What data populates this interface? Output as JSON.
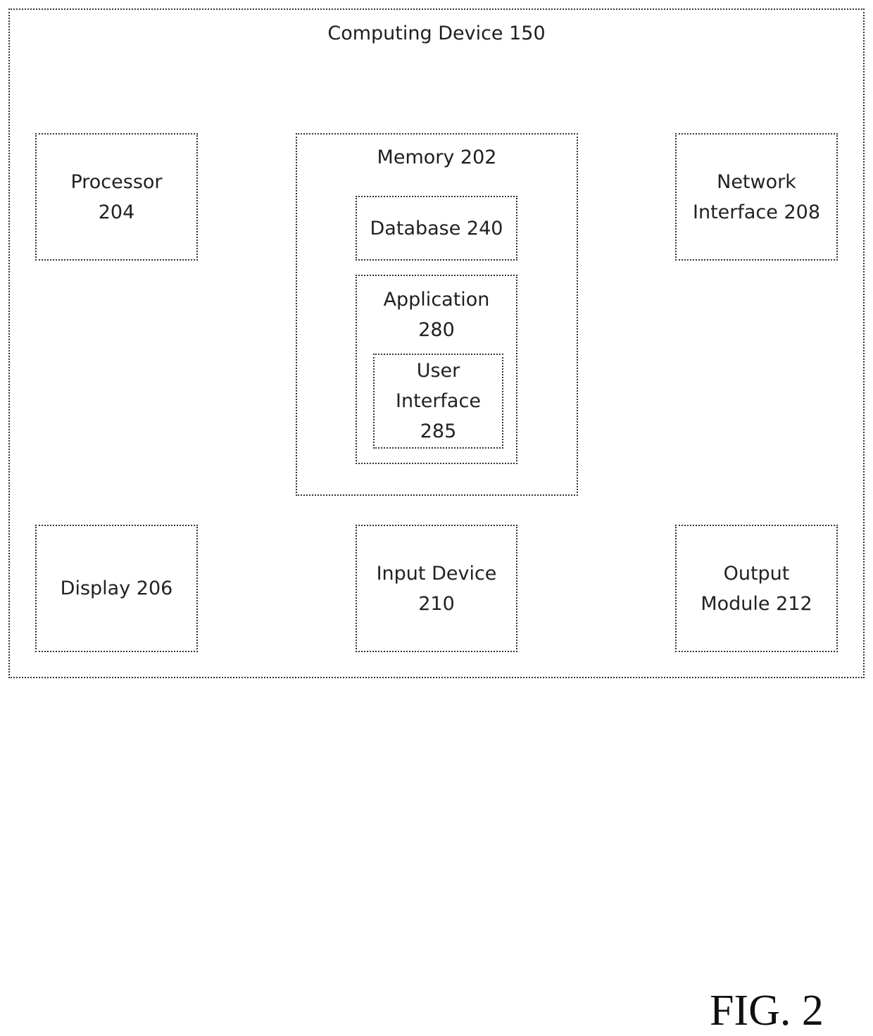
{
  "diagram": {
    "device": {
      "label": "Computing Device 150"
    },
    "processor": {
      "lines": [
        "Processor",
        "204"
      ]
    },
    "memory": {
      "label": "Memory 202"
    },
    "database": {
      "label": "Database 240"
    },
    "application": {
      "lines": [
        "Application",
        "280"
      ]
    },
    "user_interface": {
      "lines": [
        "User",
        "Interface",
        "285"
      ]
    },
    "network_interface": {
      "lines": [
        "Network",
        "Interface 208"
      ]
    },
    "display": {
      "label": "Display 206"
    },
    "input_device": {
      "lines": [
        "Input Device",
        "210"
      ]
    },
    "output_module": {
      "lines": [
        "Output",
        "Module 212"
      ]
    }
  },
  "figure_label": "FIG. 2"
}
